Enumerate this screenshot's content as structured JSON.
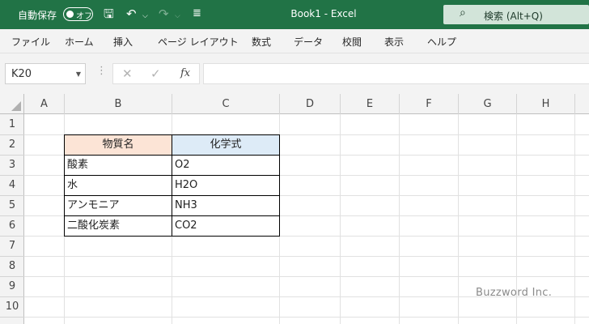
{
  "titlebar": {
    "autosave_label": "自動保存",
    "autosave_state": "オフ",
    "document_title": "Book1  -  Excel",
    "search_label": "検索 (Alt+Q)"
  },
  "menu": [
    {
      "label": "ファイル"
    },
    {
      "label": "ホーム"
    },
    {
      "label": "挿入"
    },
    {
      "label": "ページ レイアウト"
    },
    {
      "label": "数式"
    },
    {
      "label": "データ"
    },
    {
      "label": "校閲"
    },
    {
      "label": "表示"
    },
    {
      "label": "ヘルプ"
    }
  ],
  "formula_bar": {
    "name_box": "K20",
    "formula": ""
  },
  "columns": [
    "A",
    "B",
    "C",
    "D",
    "E",
    "F",
    "G",
    "H"
  ],
  "rows": [
    "1",
    "2",
    "3",
    "4",
    "5",
    "6",
    "7",
    "8",
    "9",
    "10"
  ],
  "table": {
    "headers": [
      "物質名",
      "化学式"
    ],
    "header_colors": [
      "#fce4d6",
      "#ddebf7"
    ],
    "rows": [
      [
        "酸素",
        "O2"
      ],
      [
        "水",
        "H2O"
      ],
      [
        "アンモニア",
        "NH3"
      ],
      [
        "二酸化炭素",
        "CO2"
      ]
    ]
  },
  "watermark": "Buzzword Inc.",
  "colors": {
    "title_bar": "#217346",
    "ribbon": "#f3f3f3",
    "gridline": "#e1e1e1"
  }
}
